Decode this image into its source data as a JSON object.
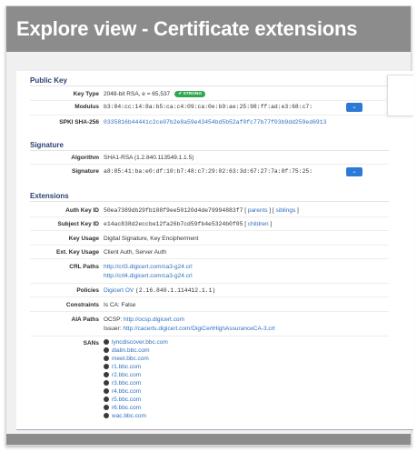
{
  "header": {
    "title": "Explore view - Certificate extensions"
  },
  "icons": {
    "expand": "chevron-down-icon",
    "san": "globe-icon"
  },
  "colors": {
    "accent": "#2d7ad6",
    "link": "#2f6fbf",
    "badge_ok": "#2fa84f",
    "heading": "#2a3f73"
  },
  "public_key": {
    "heading": "Public Key",
    "key_type": {
      "label": "Key Type",
      "value": "2048-bit RSA, e = 65,537",
      "badge": "✔ STRONG"
    },
    "modulus": {
      "label": "Modulus",
      "value": "b3:84:cc:14:8a:b5:ca:c4:09:ca:0e:b9:ae:25:98:ff:ad:e3:68:c7:"
    },
    "spki": {
      "label": "SPKI SHA-256",
      "value": "0335816b44441c2ce07b2e8a59e43454bd5b52af0fc77b77f03b9dd259ed6913"
    }
  },
  "signature": {
    "heading": "Signature",
    "algorithm": {
      "label": "Algorithm",
      "value": "SHA1-RSA (1.2.840.113549.1.1.5)"
    },
    "sig": {
      "label": "Signature",
      "value": "a8:85:41:ba:e0:df:10:b7:48:c7:29:02:63:3d:67:27:7a:8f:75:25:"
    }
  },
  "extensions": {
    "heading": "Extensions",
    "auth_key_id": {
      "label": "Auth Key ID",
      "value": "50ea7389db29fb108f9ee50120d4de79994883f7",
      "link1": "parents",
      "link2": "siblings"
    },
    "subject_key_id": {
      "label": "Subject Key ID",
      "value": "e14ac838d2eccbe12fa26b7cd59fb4e5324b0f05",
      "link1": "children"
    },
    "key_usage": {
      "label": "Key Usage",
      "value": "Digital Signature, Key Encipherment"
    },
    "ext_key_usage": {
      "label": "Ext. Key Usage",
      "value": "Client Auth, Server Auth"
    },
    "crl_paths": {
      "label": "CRL Paths",
      "values": [
        "http://crl3.digicert.com/ca3-g24.crl",
        "http://crl4.digicert.com/ca3-g24.crl"
      ]
    },
    "policies": {
      "label": "Policies",
      "link": "Digicert OV",
      "value": "(2.16.840.1.114412.1.1)"
    },
    "constraints": {
      "label": "Constraints",
      "value": "Is CA: False"
    },
    "aia_paths": {
      "label": "AIA Paths",
      "ocsp_label": "OCSP:",
      "ocsp_url": "http://ocsp.digicert.com",
      "issuer_label": "Issuer:",
      "issuer_url": "http://cacerts.digicert.com/DigiCertHighAssuranceCA-3.crt"
    },
    "sans": {
      "label": "SANs",
      "items": [
        "lyncdiscover.bbc.com",
        "dialin.bbc.com",
        "meet.bbc.com",
        "r1.bbc.com",
        "r2.bbc.com",
        "r3.bbc.com",
        "r4.bbc.com",
        "r5.bbc.com",
        "r6.bbc.com",
        "wac.bbc.com"
      ]
    }
  }
}
